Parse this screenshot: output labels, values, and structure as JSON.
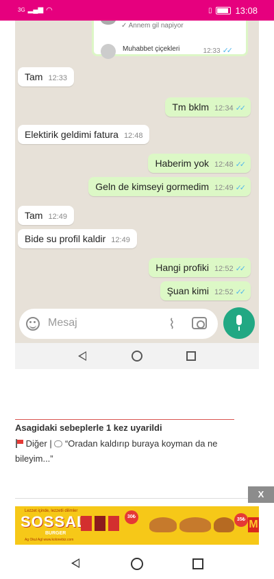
{
  "status_bar": {
    "signal": "3G",
    "time": "13:08"
  },
  "chat": {
    "preview": {
      "line1": "✓ Annem gil napiyor",
      "line2": "Muhabbet çiçekleri",
      "time": "12:33"
    },
    "messages": [
      {
        "dir": "in",
        "text": "Tam",
        "time": "12:33"
      },
      {
        "dir": "out",
        "text": "Tm bklm",
        "time": "12:34"
      },
      {
        "dir": "in",
        "text": "Elektirik geldimi fatura",
        "time": "12:48"
      },
      {
        "dir": "out",
        "text": "Haberim yok",
        "time": "12:48"
      },
      {
        "dir": "out",
        "text": "Geln de kimseyi gormedim",
        "time": "12:49"
      },
      {
        "dir": "in",
        "text": "Tam",
        "time": "12:49"
      },
      {
        "dir": "in",
        "text": "Bide su profil kaldir",
        "time": "12:49"
      },
      {
        "dir": "out",
        "text": "Hangi profiki",
        "time": "12:52"
      },
      {
        "dir": "out",
        "text": "Şuan kimi",
        "time": "12:52"
      }
    ],
    "composer_placeholder": "Mesaj"
  },
  "post": {
    "warning_title": "Asagidaki sebeplerle 1 kez uyarildi",
    "category": "Diğer",
    "quote": "“Oradan kaldırıp buraya koyman da ne bileyim...”"
  },
  "ad": {
    "close_label": "X",
    "brand": "SOSSAL",
    "sub": "BURGER",
    "small": "Lezzet içinde, lezzetli dilimler",
    "tiny": "Ag Okul Agl www.kolonebiz.com",
    "price1": "30₺",
    "price2": "35₺",
    "logo": "M"
  },
  "colors": {
    "status_bar": "#e6007e",
    "chat_bg": "#e7e1d8",
    "out_bubble": "#dcf8c6",
    "in_bubble": "#ffffff",
    "mic_button": "#21a883",
    "read_ticks": "#4fb6ec",
    "ad_bg": "#f6c818"
  }
}
